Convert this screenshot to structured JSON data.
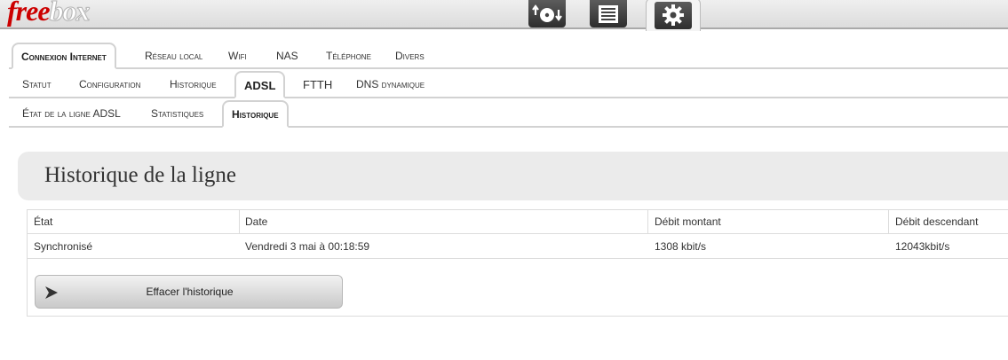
{
  "logo": {
    "part1": "free",
    "part2": "box"
  },
  "appbar": {
    "icons": [
      "disk-transfer-icon",
      "list-icon",
      "gear-icon"
    ]
  },
  "tabs_main": [
    "Connexion Internet",
    "Réseau local",
    "Wifi",
    "NAS",
    "Téléphone",
    "Divers"
  ],
  "tabs_sub": [
    "Statut",
    "Configuration",
    "Historique",
    "ADSL",
    "FTTH",
    "DNS dynamique"
  ],
  "tabs_adsl": [
    "État de la ligne ADSL",
    "Statistiques",
    "Historique"
  ],
  "panel": {
    "title": "Historique de la ligne"
  },
  "table": {
    "headers": [
      "État",
      "Date",
      "Débit montant",
      "Débit descendant"
    ],
    "rows": [
      [
        "Synchronisé",
        "Vendredi 3 mai à 00:18:59",
        "1308 kbit/s",
        "12043kbit/s"
      ]
    ]
  },
  "actions": {
    "clear_history": "Effacer l'historique"
  }
}
